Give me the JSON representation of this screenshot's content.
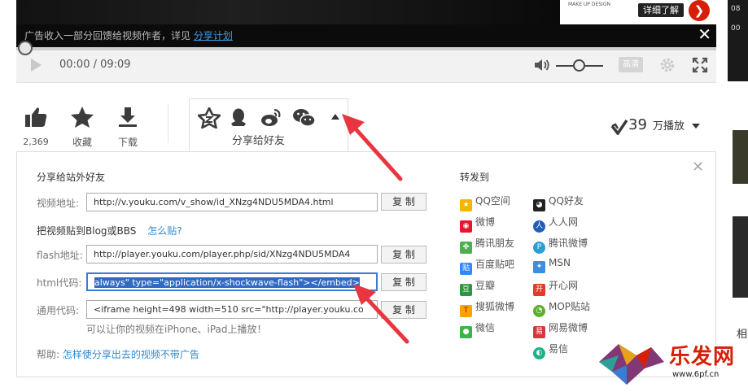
{
  "ad": {
    "banner_small_text": "MAKE UP DESIGN",
    "banner_button": "详细了解",
    "banner_go": "❯",
    "notice_prefix": "广告收入一部分回馈给视频作者，详见",
    "notice_link": "分享计划",
    "close": "✕"
  },
  "side_strip": {
    "top": "08",
    "mid": "00"
  },
  "player": {
    "time": "00:00 / 09:09",
    "quality": "高清"
  },
  "actions": {
    "like_count": "2,369",
    "favorite": "收藏",
    "download": "下载",
    "share_label": "分享给好友"
  },
  "plays": {
    "count": "39",
    "unit": "万播放"
  },
  "share_panel": {
    "close": "✕",
    "section_title": "分享给站外好友",
    "video_url_label": "视频地址:",
    "video_url": "http://v.youku.com/v_show/id_XNzg4NDU5MDA4.html",
    "blog_title": "把视频贴到Blog或BBS",
    "how_to": "怎么贴?",
    "flash_label": "flash地址:",
    "flash_url": "http://player.youku.com/player.php/sid/XNzg4NDU5MDA4",
    "html_label": "html代码:",
    "html_code": "always\" type=\"application/x-shockwave-flash\"></embed>",
    "common_label": "通用代码:",
    "common_code": "<iframe height=498 width=510 src=\"http://player.youku.co",
    "copy": "复 制",
    "mobile_hint": "可以让你的视频在iPhone、iPad上播放！",
    "help_label": "帮助:",
    "help_link": "怎样使分享出去的视频不带广告",
    "forward_title": "转发到",
    "forward_left": [
      "QQ空间",
      "微博",
      "腾讯朋友",
      "百度贴吧",
      "豆瓣",
      "搜狐微博",
      "微信"
    ],
    "forward_right": [
      "QQ好友",
      "人人网",
      "腾讯微博",
      "MSN",
      "开心网",
      "MOP贴站",
      "网易微博",
      "易信"
    ]
  },
  "side_text": "相",
  "watermark": {
    "text": "乐发网",
    "url": "www.6pf.cn"
  },
  "colors": {
    "accent": "#2a8ad4",
    "arrow": "#e8353f",
    "selection": "#316ac5"
  }
}
